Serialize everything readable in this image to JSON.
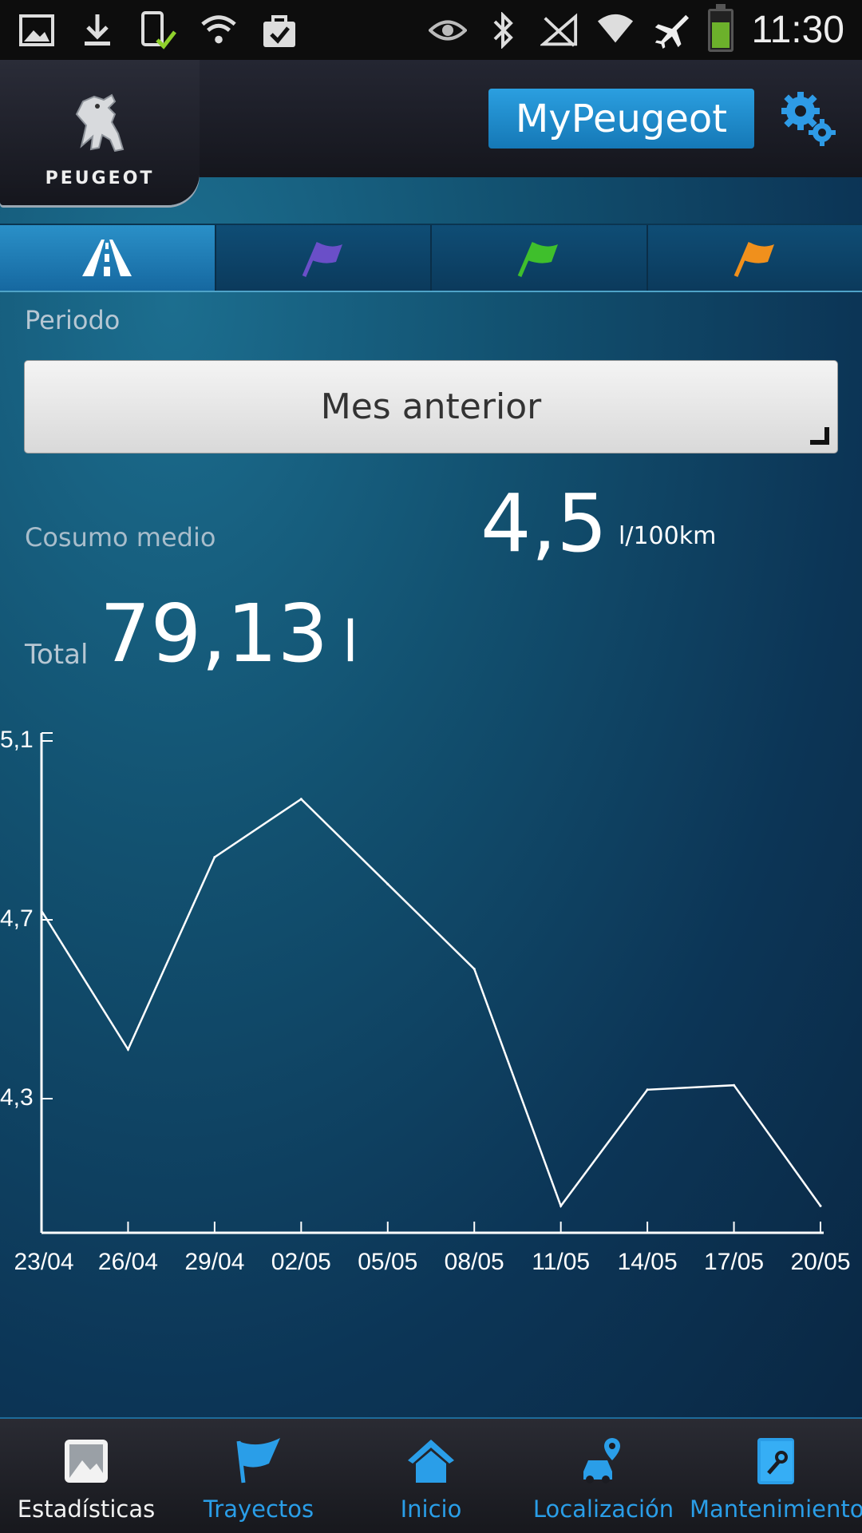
{
  "status_bar": {
    "time": "11:30"
  },
  "header": {
    "brand_logo_text": "PEUGEOT",
    "app_button": "MyPeugeot"
  },
  "tabs": [
    {
      "name": "road",
      "color": "#ffffff"
    },
    {
      "name": "flag-purple",
      "color": "#6a4fc8"
    },
    {
      "name": "flag-green",
      "color": "#3fbf2c"
    },
    {
      "name": "flag-orange",
      "color": "#f0901c"
    }
  ],
  "period": {
    "label": "Periodo",
    "selected": "Mes anterior"
  },
  "average": {
    "label": "Cosumo medio",
    "value": "4,5",
    "unit": "l/100km"
  },
  "total": {
    "label": "Total",
    "value": "79,13",
    "unit": "l"
  },
  "chart_data": {
    "type": "line",
    "x": [
      "23/04",
      "26/04",
      "29/04",
      "02/05",
      "05/05",
      "08/05",
      "11/05",
      "14/05",
      "17/05",
      "20/05"
    ],
    "series": [
      {
        "values": [
          4.72,
          4.41,
          4.84,
          4.97,
          4.78,
          4.59,
          4.06,
          4.32,
          4.33,
          4.06
        ]
      }
    ],
    "y_ticks": [
      "5,1",
      "4,7",
      "4,3"
    ],
    "y_tick_values": [
      5.1,
      4.7,
      4.3
    ],
    "ylim": [
      4.0,
      5.1
    ],
    "line_color": "#ffffff",
    "grid": false
  },
  "bottom_nav": [
    {
      "label": "Estadísticas",
      "active": true
    },
    {
      "label": "Trayectos",
      "active": false
    },
    {
      "label": "Inicio",
      "active": false
    },
    {
      "label": "Localización",
      "active": false
    },
    {
      "label": "Mantenimiento",
      "active": false
    }
  ],
  "colors": {
    "accent": "#2a9ee8",
    "brand_button": "#1a86c8"
  }
}
